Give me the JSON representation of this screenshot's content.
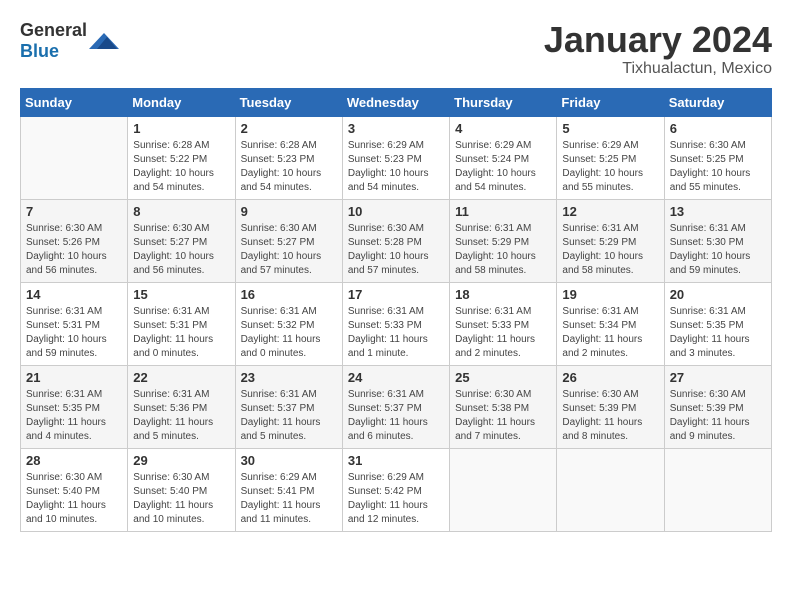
{
  "header": {
    "logo_general": "General",
    "logo_blue": "Blue",
    "title": "January 2024",
    "subtitle": "Tixhualactun, Mexico"
  },
  "calendar": {
    "weekdays": [
      "Sunday",
      "Monday",
      "Tuesday",
      "Wednesday",
      "Thursday",
      "Friday",
      "Saturday"
    ],
    "weeks": [
      [
        {
          "day": "",
          "info": ""
        },
        {
          "day": "1",
          "info": "Sunrise: 6:28 AM\nSunset: 5:22 PM\nDaylight: 10 hours\nand 54 minutes."
        },
        {
          "day": "2",
          "info": "Sunrise: 6:28 AM\nSunset: 5:23 PM\nDaylight: 10 hours\nand 54 minutes."
        },
        {
          "day": "3",
          "info": "Sunrise: 6:29 AM\nSunset: 5:23 PM\nDaylight: 10 hours\nand 54 minutes."
        },
        {
          "day": "4",
          "info": "Sunrise: 6:29 AM\nSunset: 5:24 PM\nDaylight: 10 hours\nand 54 minutes."
        },
        {
          "day": "5",
          "info": "Sunrise: 6:29 AM\nSunset: 5:25 PM\nDaylight: 10 hours\nand 55 minutes."
        },
        {
          "day": "6",
          "info": "Sunrise: 6:30 AM\nSunset: 5:25 PM\nDaylight: 10 hours\nand 55 minutes."
        }
      ],
      [
        {
          "day": "7",
          "info": "Sunrise: 6:30 AM\nSunset: 5:26 PM\nDaylight: 10 hours\nand 56 minutes."
        },
        {
          "day": "8",
          "info": "Sunrise: 6:30 AM\nSunset: 5:27 PM\nDaylight: 10 hours\nand 56 minutes."
        },
        {
          "day": "9",
          "info": "Sunrise: 6:30 AM\nSunset: 5:27 PM\nDaylight: 10 hours\nand 57 minutes."
        },
        {
          "day": "10",
          "info": "Sunrise: 6:30 AM\nSunset: 5:28 PM\nDaylight: 10 hours\nand 57 minutes."
        },
        {
          "day": "11",
          "info": "Sunrise: 6:31 AM\nSunset: 5:29 PM\nDaylight: 10 hours\nand 58 minutes."
        },
        {
          "day": "12",
          "info": "Sunrise: 6:31 AM\nSunset: 5:29 PM\nDaylight: 10 hours\nand 58 minutes."
        },
        {
          "day": "13",
          "info": "Sunrise: 6:31 AM\nSunset: 5:30 PM\nDaylight: 10 hours\nand 59 minutes."
        }
      ],
      [
        {
          "day": "14",
          "info": "Sunrise: 6:31 AM\nSunset: 5:31 PM\nDaylight: 10 hours\nand 59 minutes."
        },
        {
          "day": "15",
          "info": "Sunrise: 6:31 AM\nSunset: 5:31 PM\nDaylight: 11 hours\nand 0 minutes."
        },
        {
          "day": "16",
          "info": "Sunrise: 6:31 AM\nSunset: 5:32 PM\nDaylight: 11 hours\nand 0 minutes."
        },
        {
          "day": "17",
          "info": "Sunrise: 6:31 AM\nSunset: 5:33 PM\nDaylight: 11 hours\nand 1 minute."
        },
        {
          "day": "18",
          "info": "Sunrise: 6:31 AM\nSunset: 5:33 PM\nDaylight: 11 hours\nand 2 minutes."
        },
        {
          "day": "19",
          "info": "Sunrise: 6:31 AM\nSunset: 5:34 PM\nDaylight: 11 hours\nand 2 minutes."
        },
        {
          "day": "20",
          "info": "Sunrise: 6:31 AM\nSunset: 5:35 PM\nDaylight: 11 hours\nand 3 minutes."
        }
      ],
      [
        {
          "day": "21",
          "info": "Sunrise: 6:31 AM\nSunset: 5:35 PM\nDaylight: 11 hours\nand 4 minutes."
        },
        {
          "day": "22",
          "info": "Sunrise: 6:31 AM\nSunset: 5:36 PM\nDaylight: 11 hours\nand 5 minutes."
        },
        {
          "day": "23",
          "info": "Sunrise: 6:31 AM\nSunset: 5:37 PM\nDaylight: 11 hours\nand 5 minutes."
        },
        {
          "day": "24",
          "info": "Sunrise: 6:31 AM\nSunset: 5:37 PM\nDaylight: 11 hours\nand 6 minutes."
        },
        {
          "day": "25",
          "info": "Sunrise: 6:30 AM\nSunset: 5:38 PM\nDaylight: 11 hours\nand 7 minutes."
        },
        {
          "day": "26",
          "info": "Sunrise: 6:30 AM\nSunset: 5:39 PM\nDaylight: 11 hours\nand 8 minutes."
        },
        {
          "day": "27",
          "info": "Sunrise: 6:30 AM\nSunset: 5:39 PM\nDaylight: 11 hours\nand 9 minutes."
        }
      ],
      [
        {
          "day": "28",
          "info": "Sunrise: 6:30 AM\nSunset: 5:40 PM\nDaylight: 11 hours\nand 10 minutes."
        },
        {
          "day": "29",
          "info": "Sunrise: 6:30 AM\nSunset: 5:40 PM\nDaylight: 11 hours\nand 10 minutes."
        },
        {
          "day": "30",
          "info": "Sunrise: 6:29 AM\nSunset: 5:41 PM\nDaylight: 11 hours\nand 11 minutes."
        },
        {
          "day": "31",
          "info": "Sunrise: 6:29 AM\nSunset: 5:42 PM\nDaylight: 11 hours\nand 12 minutes."
        },
        {
          "day": "",
          "info": ""
        },
        {
          "day": "",
          "info": ""
        },
        {
          "day": "",
          "info": ""
        }
      ]
    ]
  }
}
